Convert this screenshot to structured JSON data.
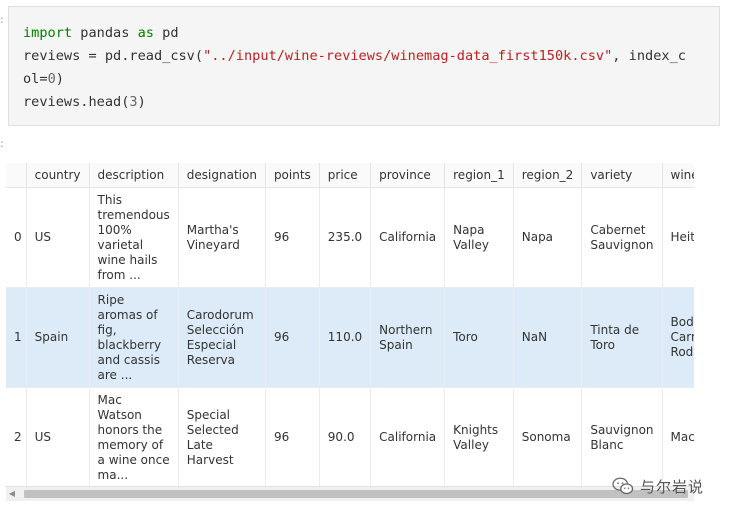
{
  "code": {
    "line1": {
      "kw1": "import",
      "mid": " pandas ",
      "kw2": "as",
      "end": " pd"
    },
    "line2": {
      "pre": "reviews = pd.read_csv(",
      "str": "\"../input/wine-reviews/winemag-data_first150k.csv\"",
      "post": ", index_c"
    },
    "line3": {
      "pre": "ol=",
      "num": "0",
      "post": ")"
    },
    "line4": {
      "pre": "reviews.head(",
      "num": "3",
      "post": ")"
    }
  },
  "table": {
    "columns": [
      "country",
      "description",
      "designation",
      "points",
      "price",
      "province",
      "region_1",
      "region_2",
      "variety",
      "winery"
    ],
    "rows": [
      {
        "index": "0",
        "country": "US",
        "description": "This tremendous 100% varietal wine hails from ...",
        "designation": "Martha's Vineyard",
        "points": "96",
        "price": "235.0",
        "province": "California",
        "region_1": "Napa Valley",
        "region_2": "Napa",
        "variety": "Cabernet Sauvignon",
        "winery": "Heitz"
      },
      {
        "index": "1",
        "country": "Spain",
        "description": "Ripe aromas of fig, blackberry and cassis are ...",
        "designation": "Carodorum Selección Especial Reserva",
        "points": "96",
        "price": "110.0",
        "province": "Northern Spain",
        "region_1": "Toro",
        "region_2": "NaN",
        "variety": "Tinta de Toro",
        "winery": "Bodega Carmen Rodríguez"
      },
      {
        "index": "2",
        "country": "US",
        "description": "Mac Watson honors the memory of a wine once ma...",
        "designation": "Special Selected Late Harvest",
        "points": "96",
        "price": "90.0",
        "province": "California",
        "region_1": "Knights Valley",
        "region_2": "Sonoma",
        "variety": "Sauvignon Blanc",
        "winery": "Macauley"
      }
    ]
  },
  "watermark": {
    "text": "与尔岩说",
    "icon": "wechat-icon"
  },
  "colors": {
    "keyword": "#008000",
    "string": "#ba2121",
    "selected_row": "#dcebf7",
    "code_bg": "#f5f5f5"
  }
}
